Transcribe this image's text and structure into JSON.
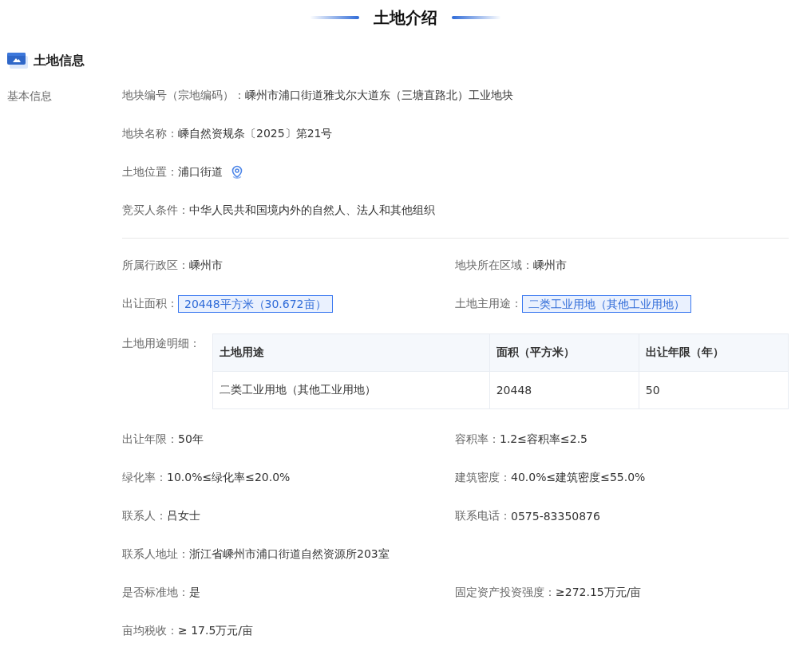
{
  "page_title": "土地介绍",
  "section": {
    "title": "土地信息"
  },
  "group_label": "基本信息",
  "basic_fields": [
    {
      "kind": "text",
      "label": "地块编号（宗地编码）：",
      "value": "嵊州市浦口街道雅戈尔大道东（三塘直路北）工业地块"
    },
    {
      "kind": "text",
      "label": "地块名称：",
      "value": "嵊自然资规条〔2025〕第21号"
    },
    {
      "kind": "location",
      "label": "土地位置：",
      "value": "浦口街道"
    },
    {
      "kind": "text",
      "label": "竞买人条件：",
      "value": "中华人民共和国境内外的自然人、法人和其他组织"
    }
  ],
  "detail_rows_top": [
    [
      {
        "kind": "text",
        "label": "所属行政区：",
        "value": "嵊州市"
      },
      {
        "kind": "text",
        "label": "地块所在区域：",
        "value": "嵊州市"
      }
    ],
    [
      {
        "kind": "tag",
        "label": "出让面积：",
        "value": "20448平方米（30.672亩）"
      },
      {
        "kind": "tag",
        "label": "土地主用途：",
        "value": "二类工业用地（其他工业用地）"
      }
    ]
  ],
  "usage_table": {
    "label": "土地用途明细：",
    "columns": [
      "土地用途",
      "面积（平方米）",
      "出让年限（年）"
    ],
    "rows": [
      [
        "二类工业用地（其他工业用地）",
        "20448",
        "50"
      ]
    ]
  },
  "detail_rows_bottom": [
    [
      {
        "kind": "text",
        "label": "出让年限：",
        "value": "50年"
      },
      {
        "kind": "text",
        "label": "容积率：",
        "value": "1.2≤容积率≤2.5"
      }
    ],
    [
      {
        "kind": "text",
        "label": "绿化率：",
        "value": "10.0%≤绿化率≤20.0%"
      },
      {
        "kind": "text",
        "label": "建筑密度：",
        "value": "40.0%≤建筑密度≤55.0%"
      }
    ],
    [
      {
        "kind": "text",
        "label": "联系人：",
        "value": "吕女士"
      },
      {
        "kind": "text",
        "label": "联系电话：",
        "value": "0575-83350876"
      }
    ],
    [
      {
        "kind": "text",
        "label": "联系人地址：",
        "value": "浙江省嵊州市浦口街道自然资源所203室"
      }
    ],
    [
      {
        "kind": "text",
        "label": "是否标准地：",
        "value": "是"
      },
      {
        "kind": "text",
        "label": "固定资产投资强度：",
        "value": "≥272.15万元/亩"
      }
    ],
    [
      {
        "kind": "text",
        "label": "亩均税收：",
        "value": "≥ 17.5万元/亩"
      }
    ]
  ]
}
